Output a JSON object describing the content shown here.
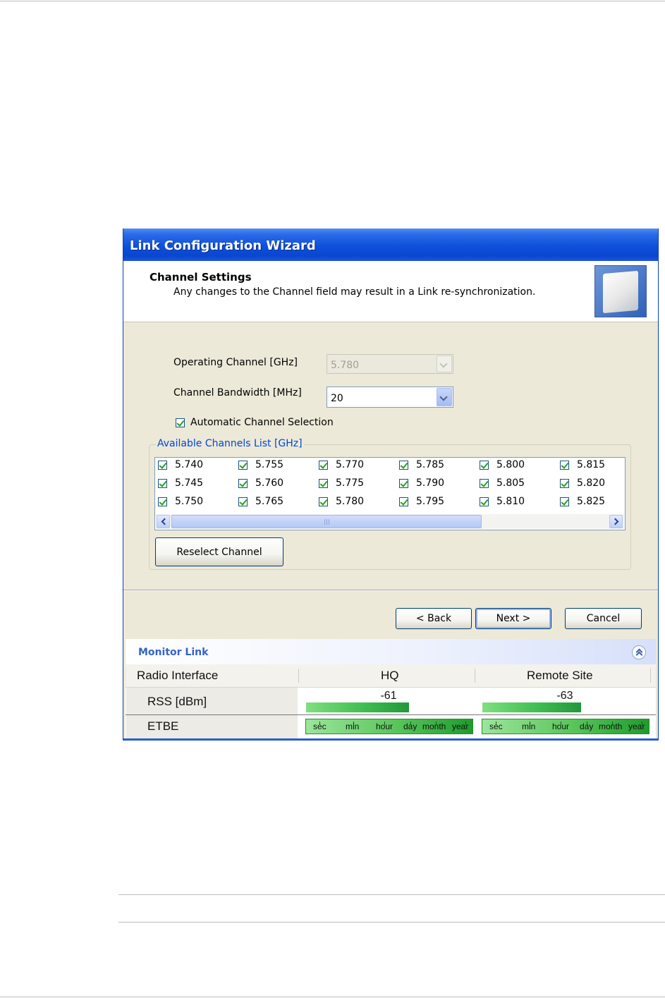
{
  "window": {
    "title": "Link Configuration Wizard"
  },
  "header": {
    "title": "Channel Settings",
    "subtitle": "Any changes to the Channel field may result in a Link re-synchronization."
  },
  "form": {
    "operating_channel": {
      "label": "Operating Channel [GHz]",
      "value": "5.780",
      "disabled": true
    },
    "channel_bandwidth": {
      "label": "Channel Bandwidth [MHz]",
      "value": "20"
    },
    "automatic_selection": {
      "label": "Automatic Channel Selection",
      "checked": true
    }
  },
  "channels": {
    "legend": "Available Channels List [GHz]",
    "columns": [
      [
        "5.740",
        "5.745",
        "5.750"
      ],
      [
        "5.755",
        "5.760",
        "5.765"
      ],
      [
        "5.770",
        "5.775",
        "5.780"
      ],
      [
        "5.785",
        "5.790",
        "5.795"
      ],
      [
        "5.800",
        "5.805",
        "5.810"
      ],
      [
        "5.815",
        "5.820",
        "5.825"
      ]
    ],
    "all_checked": true,
    "reselect_label": "Reselect Channel"
  },
  "buttons": {
    "back": "< Back",
    "next": "Next >",
    "cancel": "Cancel"
  },
  "monitor": {
    "title": "Monitor Link",
    "headers": [
      "Radio Interface",
      "HQ",
      "Remote Site"
    ],
    "rss": {
      "label": "RSS [dBm]",
      "hq": "-61",
      "remote": "-63"
    },
    "etbe": {
      "label": "ETBE",
      "scale": [
        "sec",
        "min",
        "hour",
        "day",
        "month",
        "year"
      ]
    },
    "colors": {
      "bar_start": "#7fe07f",
      "bar_end": "#21983a"
    }
  }
}
